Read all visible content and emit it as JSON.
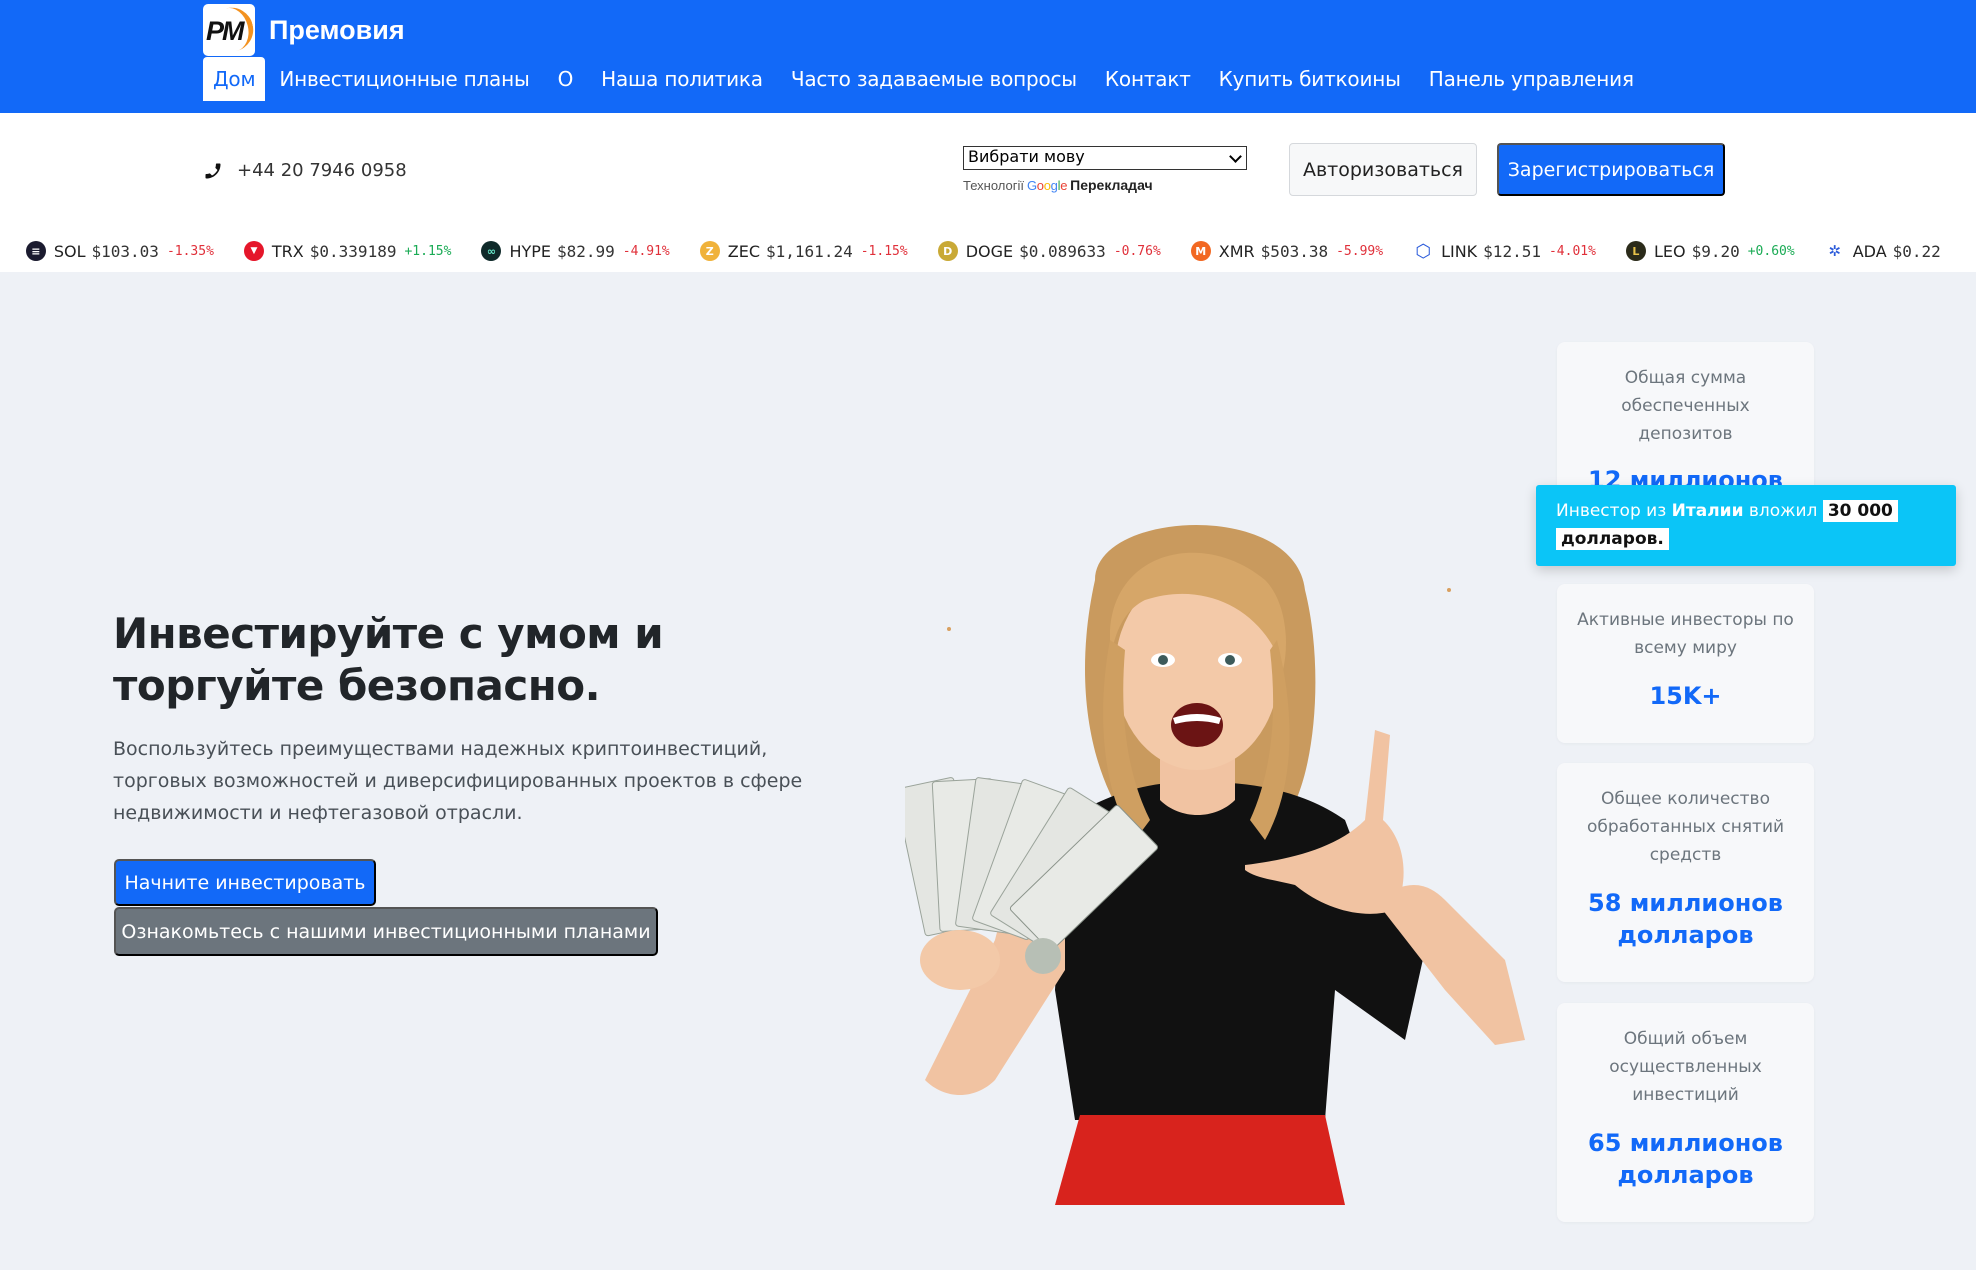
{
  "brand": {
    "logo_text": "PM",
    "name": "Премовия"
  },
  "nav": {
    "items": [
      {
        "label": "Дом",
        "active": true
      },
      {
        "label": "Инвестиционные планы"
      },
      {
        "label": "О"
      },
      {
        "label": "Наша политика"
      },
      {
        "label": "Часто задаваемые вопросы"
      },
      {
        "label": "Контакт"
      },
      {
        "label": "Купить биткоины"
      },
      {
        "label": "Панель управления"
      }
    ]
  },
  "contact": {
    "phone": "+44 20 7946 0958"
  },
  "translate": {
    "select_value": "Вибрати мову",
    "powered_prefix": "Технології",
    "google": "Google",
    "product": "Перекладач"
  },
  "auth": {
    "login_label": "Авторизоваться",
    "register_label": "Зарегистрироваться"
  },
  "ticker": [
    {
      "symbol": "",
      "price": "",
      "change": "%",
      "dir": "neg",
      "icon_color": "#ffffff",
      "icon": ""
    },
    {
      "symbol": "SOL",
      "price": "$103.03",
      "change": "-1.35%",
      "dir": "neg",
      "icon_color": "#1b1b2f",
      "icon": "≡"
    },
    {
      "symbol": "TRX",
      "price": "$0.339189",
      "change": "+1.15%",
      "dir": "pos",
      "icon_color": "#e5162a",
      "icon": "▼"
    },
    {
      "symbol": "HYPE",
      "price": "$82.99",
      "change": "-4.91%",
      "dir": "neg",
      "icon_color": "#0f2a2a",
      "icon": "∞"
    },
    {
      "symbol": "ZEC",
      "price": "$1,161.24",
      "change": "-1.15%",
      "dir": "neg",
      "icon_color": "#f0b23a",
      "icon": "Z"
    },
    {
      "symbol": "DOGE",
      "price": "$0.089633",
      "change": "-0.76%",
      "dir": "neg",
      "icon_color": "#c9a936",
      "icon": "D"
    },
    {
      "symbol": "XMR",
      "price": "$503.38",
      "change": "-5.99%",
      "dir": "neg",
      "icon_color": "#f26822",
      "icon": "M"
    },
    {
      "symbol": "LINK",
      "price": "$12.51",
      "change": "-4.01%",
      "dir": "neg",
      "icon_color": "#2a5ada",
      "icon": "⬡"
    },
    {
      "symbol": "LEO",
      "price": "$9.20",
      "change": "+0.60%",
      "dir": "pos",
      "icon_color": "#2b2b1a",
      "icon": "L"
    },
    {
      "symbol": "ADA",
      "price": "$0.22",
      "change": "",
      "dir": "neg",
      "icon_color": "#ffffff",
      "icon": "✲"
    }
  ],
  "hero": {
    "title": "Инвестируйте с умом и торгуйте безопасно.",
    "text": "Воспользуйтесь преимуществами надежных криптоинвестиций, торговых возможностей и диверсифицированных проектов в сфере недвижимости и нефтегазовой отрасли.",
    "cta_primary": "Начните инвестировать",
    "cta_secondary": "Ознакомьтесь с нашими инвестиционными планами"
  },
  "stats": [
    {
      "label": "Общая сумма обеспеченных депозитов",
      "value": "12 миллионов"
    },
    {
      "label": "Активные инвесторы по всему миру",
      "value": "15K+"
    },
    {
      "label": "Общее количество обработанных снятий средств",
      "value": "58 миллионов долларов"
    },
    {
      "label": "Общий объем осуществленных инвестиций",
      "value": "65 миллионов долларов"
    }
  ],
  "toast": {
    "prefix": "Инвестор из",
    "country": "Италии",
    "verb": "вложил",
    "amount": "30 000",
    "currency": "долларов."
  },
  "colors": {
    "primary": "#1269f8",
    "secondary": "#6c757d",
    "toast": "#0bc5f7",
    "negative": "#e0303a",
    "positive": "#1aab55"
  }
}
